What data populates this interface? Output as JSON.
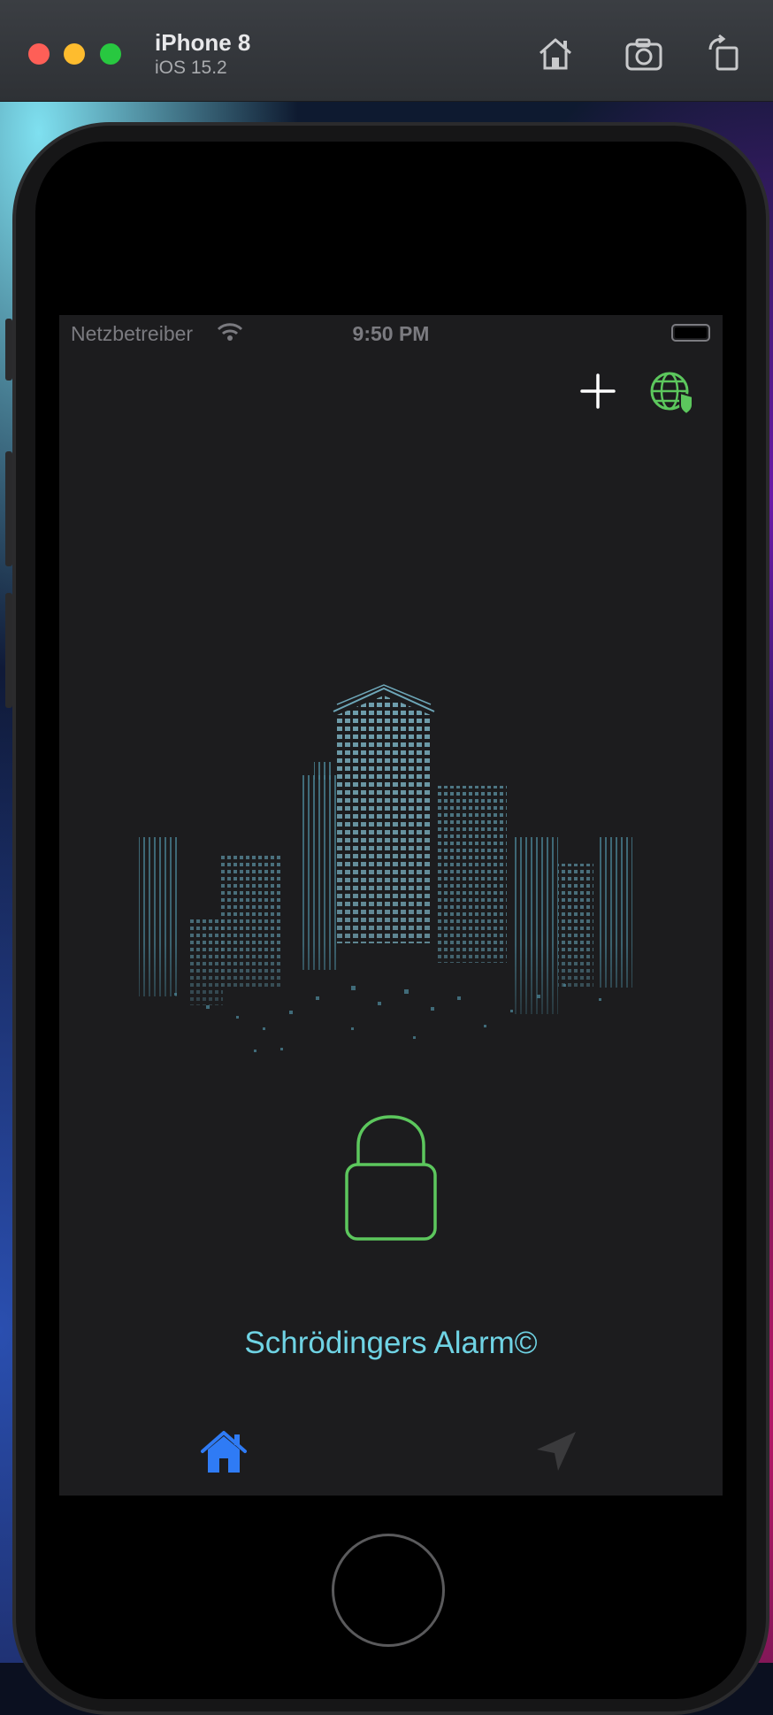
{
  "simulator": {
    "device_name": "iPhone 8",
    "os_version": "iOS 15.2",
    "toolbar_icons": [
      "home-icon",
      "screenshot-camera-icon",
      "rotate-icon"
    ]
  },
  "statusbar": {
    "carrier": "Netzbetreiber",
    "time": "9:50 PM",
    "icons": [
      "wifi-icon",
      "battery-icon"
    ]
  },
  "navbar": {
    "icons": [
      "plus-icon",
      "globe-shield-icon"
    ]
  },
  "main": {
    "illustration": "city-skyline",
    "lock_icon": "lock-icon",
    "app_title": "Schrödingers Alarm©"
  },
  "tabbar": {
    "items": [
      {
        "icon": "house-icon",
        "selected": true
      },
      {
        "icon": "location-arrow-icon",
        "selected": false
      }
    ]
  },
  "colors": {
    "accent_green": "#5cc75d",
    "title_cyan": "#6fd3e4",
    "tab_selected": "#2f7bf5",
    "screen_bg": "#1c1c1e"
  }
}
